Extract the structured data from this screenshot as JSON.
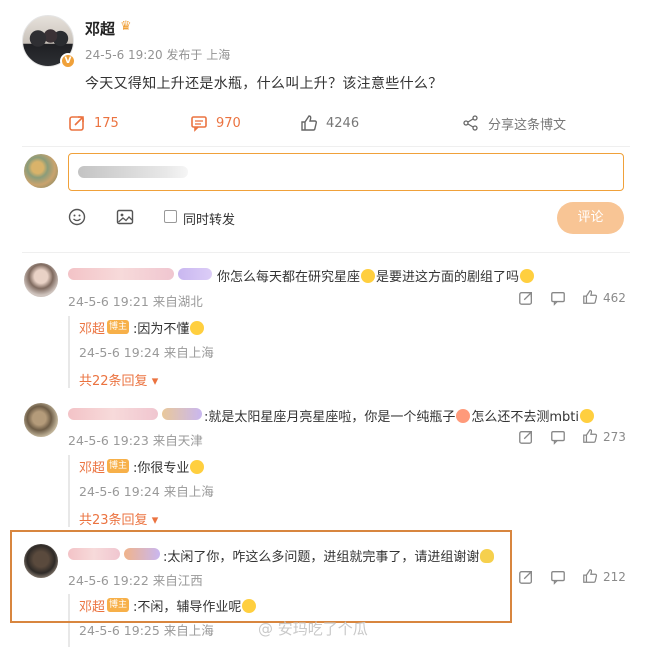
{
  "post": {
    "username": "邓超",
    "meta": "24-5-6 19:20 发布于 上海",
    "text": "今天又得知上升还是水瓶，什么叫上升？该注意些什么？",
    "verify_badge": "V"
  },
  "actions": {
    "repost_count": "175",
    "comment_count": "970",
    "like_count": "4246",
    "share_label": "分享这条博文"
  },
  "composer": {
    "placeholder": "",
    "repost_label": "同时转发",
    "submit_label": "评论"
  },
  "comments": [
    {
      "text": "你怎么每天都在研究星座",
      "text2": "是要进这方面的剧组了吗",
      "meta": "24-5-6 19:21 来自湖北",
      "likes": "462",
      "reply_name": "邓超",
      "reply_badge": "博主",
      "reply_text": ":因为不懂",
      "reply_meta": "24-5-6 19:24 来自上海",
      "more": "共22条回复"
    },
    {
      "text": ":就是太阳星座月亮星座啦，你是一个纯瓶子",
      "text2": "怎么还不去测mbti",
      "meta": "24-5-6 19:23 来自天津",
      "likes": "273",
      "reply_name": "邓超",
      "reply_badge": "博主",
      "reply_text": ":你很专业",
      "reply_meta": "24-5-6 19:24 来自上海",
      "more": "共23条回复"
    },
    {
      "text": ":太闲了你，咋这么多问题，进组就完事了，请进组谢谢",
      "meta": "24-5-6 19:22 来自江西",
      "likes": "212",
      "reply_name": "邓超",
      "reply_badge": "博主",
      "reply_text": ":不闲，辅导作业呢",
      "reply_meta": "24-5-6 19:25 来自上海"
    }
  ],
  "watermark": "@ 安玛吃了个瓜",
  "colors": {
    "accent": "#eb7340",
    "submit": "#f8c595",
    "highlight": "#d8863f"
  }
}
